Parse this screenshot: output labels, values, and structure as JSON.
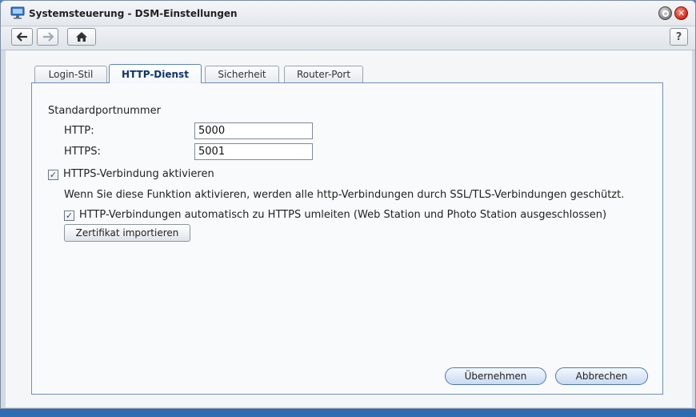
{
  "window": {
    "title": "Systemsteuerung - DSM-Einstellungen",
    "icons": {
      "app": "monitor-icon",
      "minimize": "minimize-icon",
      "close": "close-icon"
    }
  },
  "toolbar": {
    "back_icon": "arrow-left-icon",
    "forward_icon": "arrow-right-icon",
    "home_icon": "home-icon",
    "help_label": "?"
  },
  "tabs": [
    {
      "label": "Login-Stil",
      "active": false
    },
    {
      "label": "HTTP-Dienst",
      "active": true
    },
    {
      "label": "Sicherheit",
      "active": false
    },
    {
      "label": "Router-Port",
      "active": false
    }
  ],
  "form": {
    "section_title": "Standardportnummer",
    "http_label": "HTTP:",
    "http_value": "5000",
    "https_label": "HTTPS:",
    "https_value": "5001",
    "enable_https": {
      "label": "HTTPS-Verbindung aktivieren",
      "checked": true
    },
    "description": "Wenn Sie diese Funktion aktivieren, werden alle http-Verbindungen durch SSL/TLS-Verbindungen geschützt.",
    "redirect_https": {
      "label": "HTTP-Verbindungen automatisch zu HTTPS umleiten (Web Station und Photo Station ausgeschlossen)",
      "checked": true
    },
    "import_cert_label": "Zertifikat importieren"
  },
  "footer": {
    "apply_label": "Übernehmen",
    "cancel_label": "Abbrechen"
  },
  "colors": {
    "active_tab_text": "#10346a",
    "panel_border": "#6e90b8",
    "close_button": "#d42b1a"
  }
}
